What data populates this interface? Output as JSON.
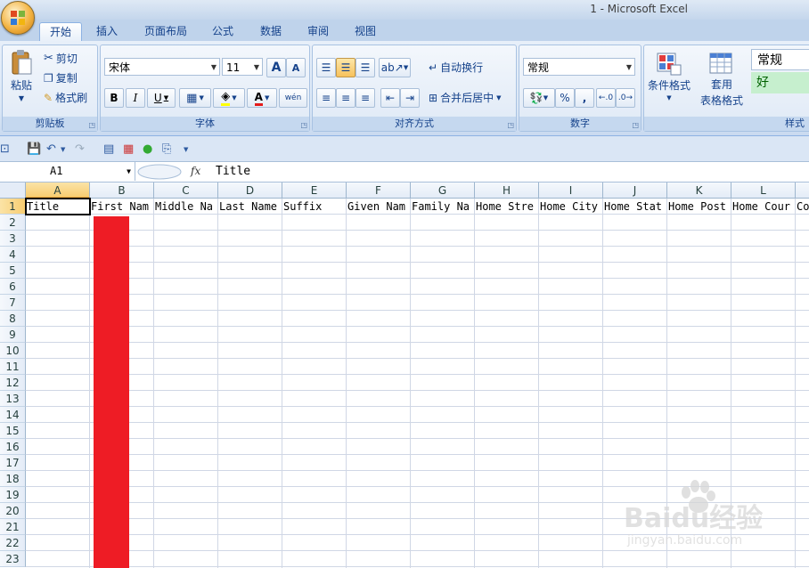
{
  "window": {
    "title": "1 - Microsoft Excel"
  },
  "tabs": [
    "开始",
    "插入",
    "页面布局",
    "公式",
    "数据",
    "审阅",
    "视图"
  ],
  "ribbon": {
    "clipboard": {
      "label": "剪贴板",
      "paste": "粘贴",
      "cut": "剪切",
      "copy": "复制",
      "format_painter": "格式刷"
    },
    "font": {
      "label": "字体",
      "font_name": "宋体",
      "font_size": "11",
      "grow": "A",
      "shrink": "A",
      "bold": "B",
      "italic": "I",
      "underline": "U",
      "font_color_letter": "A",
      "phonetic": "wén"
    },
    "alignment": {
      "label": "对齐方式",
      "wrap_text": "自动换行",
      "merge_center": "合并后居中"
    },
    "number": {
      "label": "数字",
      "format": "常规",
      "percent": "%",
      "comma": ","
    },
    "styles": {
      "label": "样式",
      "conditional": "条件格式",
      "table_format_1": "套用",
      "table_format_2": "表格格式",
      "style_normal": "常规",
      "style_good": "好"
    }
  },
  "formula_bar": {
    "name_box": "A1",
    "fx": "fx",
    "value": "Title"
  },
  "sheet": {
    "columns": [
      "A",
      "B",
      "C",
      "D",
      "E",
      "F",
      "G",
      "H",
      "I",
      "J",
      "K",
      "L"
    ],
    "rows": [
      "1",
      "2",
      "3",
      "4",
      "5",
      "6",
      "7",
      "8",
      "9",
      "10",
      "11",
      "12",
      "13",
      "14",
      "15",
      "16",
      "17",
      "18",
      "19",
      "20",
      "21",
      "22",
      "23"
    ],
    "row1": [
      "Title",
      "First Nam",
      "Middle Na",
      "Last Name",
      "Suffix",
      "Given Nam",
      "Family Na",
      "Home Stre",
      "Home City",
      "Home Stat",
      "Home Post",
      "Home Cour",
      "Co"
    ],
    "redaction_color": "#ee1c25"
  },
  "watermark": {
    "brand": "Baidu经验",
    "url": "jingyan.baidu.com"
  }
}
